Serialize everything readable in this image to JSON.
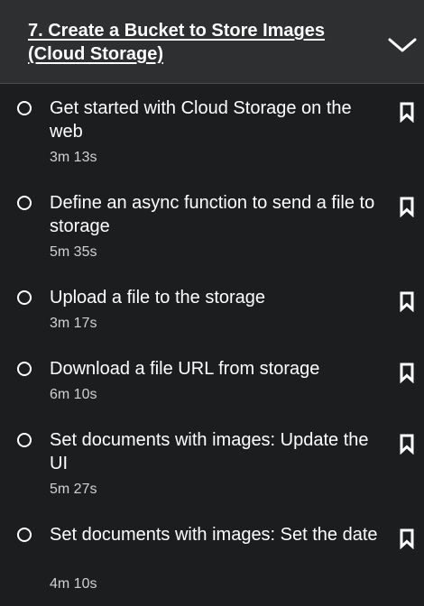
{
  "section": {
    "title": "7. Create a Bucket to Store Images (Cloud Storage)",
    "expanded": false,
    "icon": "chevron-down-icon"
  },
  "lectures": [
    {
      "title": "Get started with Cloud Storage on the web",
      "duration": "3m 13s",
      "completed": false
    },
    {
      "title": "Define an async function to send a file to storage",
      "duration": "5m 35s",
      "completed": false
    },
    {
      "title": "Upload a file to the storage",
      "duration": "3m 17s",
      "completed": false
    },
    {
      "title": "Download a file URL from storage",
      "duration": "6m 10s",
      "completed": false
    },
    {
      "title": "Set documents with images: Update the UI",
      "duration": "5m 27s",
      "completed": false
    },
    {
      "title": "Set documents with images: Set the date",
      "duration": "4m 10s",
      "completed": false
    }
  ],
  "colors": {
    "background": "#1c1d1f",
    "header_background": "#2d2f31",
    "text": "#ffffff",
    "muted_text": "#cfd1d3"
  }
}
